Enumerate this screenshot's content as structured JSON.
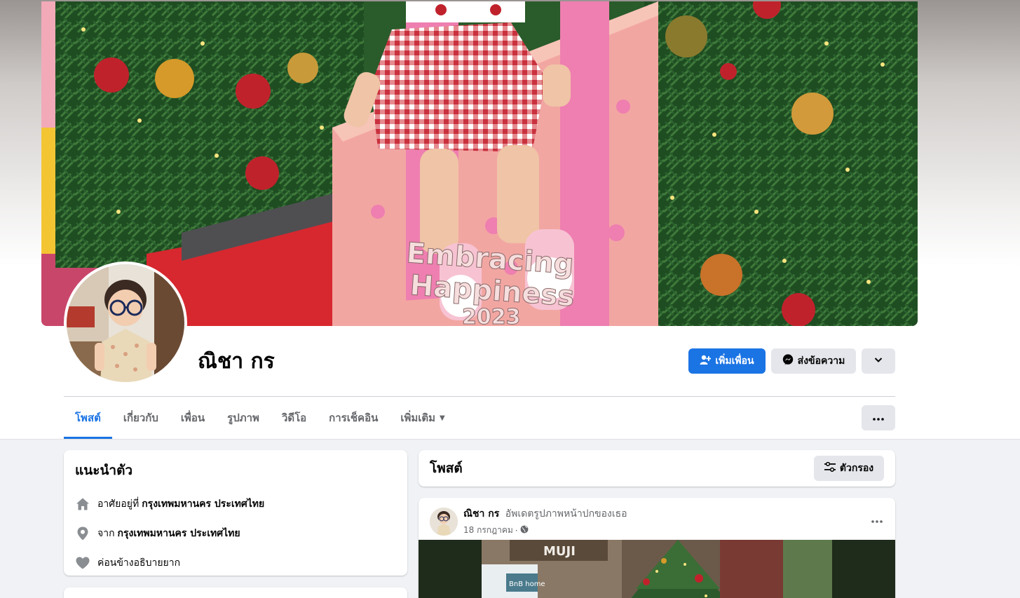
{
  "profile": {
    "name": "ณิชา กร"
  },
  "cover": {
    "sign_line1": "Embracing",
    "sign_line2": "Happiness",
    "sign_line3": "2023"
  },
  "actions": {
    "add_friend": "เพิ่มเพื่อน",
    "message": "ส่งข้อความ"
  },
  "tabs": [
    {
      "label": "โพสต์"
    },
    {
      "label": "เกี่ยวกับ"
    },
    {
      "label": "เพื่อน"
    },
    {
      "label": "รูปภาพ"
    },
    {
      "label": "วิดีโอ"
    },
    {
      "label": "การเช็คอิน"
    },
    {
      "label": "เพิ่มเติม"
    }
  ],
  "intro": {
    "title": "แนะนำตัว",
    "lives_prefix": "อาศัยอยู่ที่",
    "lives_value": "กรุงเทพมหานคร ประเทศไทย",
    "from_prefix": "จาก",
    "from_value": "กรุงเทพมหานคร ประเทศไทย",
    "relationship": "ค่อนข้างอธิบายยาก"
  },
  "posts": {
    "title": "โพสต์",
    "filter_label": "ตัวกรอง"
  },
  "post": {
    "author": "ณิชา กร",
    "action": "อัพเดตรูปภาพหน้าปกของเธอ",
    "date": "18 กรกฎาคม",
    "separator": "·",
    "image_sign": "MUJI",
    "image_sign2": "BnB home"
  },
  "colors": {
    "accent": "#1b74e4",
    "button_gray": "#e4e6eb",
    "page_bg": "#f0f2f5"
  }
}
